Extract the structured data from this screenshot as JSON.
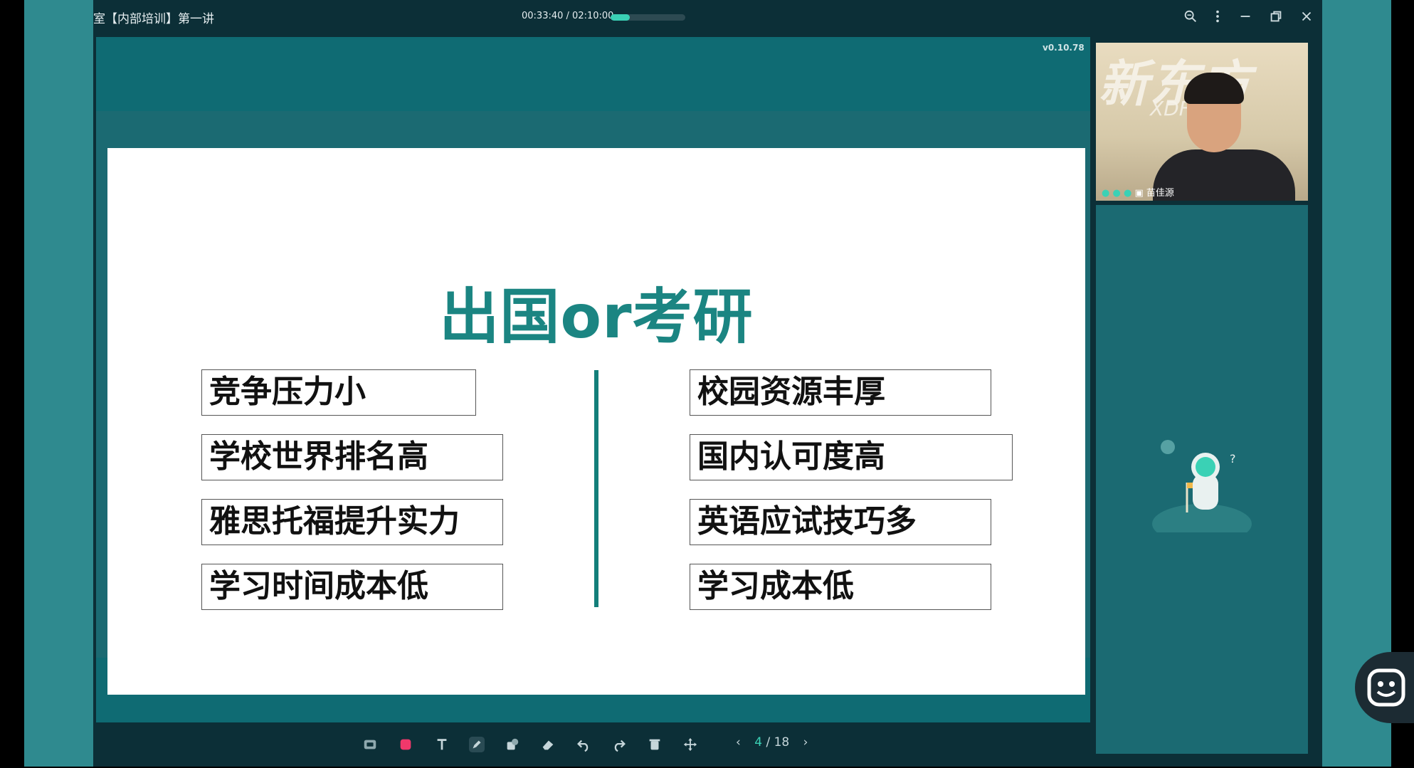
{
  "titlebar": {
    "title": "室【内部培训】第一讲",
    "time_current": "00:33:40",
    "time_total": "/ 02:10:00",
    "progress": 0.26,
    "icons": [
      "zoom-search-icon",
      "more-vertical-icon",
      "minimize-icon",
      "restore-icon",
      "close-icon"
    ]
  },
  "stage": {
    "version": "v0.10.78"
  },
  "slide": {
    "title": "出国or考研",
    "left_items": [
      "竞争压力小",
      "学校世界排名高",
      "雅思托福提升实力",
      "学习时间成本低"
    ],
    "right_items": [
      "校园资源丰厚",
      "国内认可度高",
      "英语应试技巧多",
      "学习成本低"
    ]
  },
  "toolbar": {
    "tools": [
      "select-icon",
      "color-icon",
      "text-icon",
      "pen-icon",
      "shape-icon",
      "eraser-icon",
      "undo-icon",
      "redo-icon",
      "delete-icon",
      "move-icon"
    ],
    "page_current": "4",
    "page_total": "/ 18"
  },
  "video": {
    "logo": "新东方",
    "logo_sub": "XDF",
    "name": "苗佳源"
  },
  "colors": {
    "accent": "#3ad1b5",
    "slide_title": "#1b8582",
    "background": "#0c2f37",
    "stage": "#0f6b73"
  }
}
